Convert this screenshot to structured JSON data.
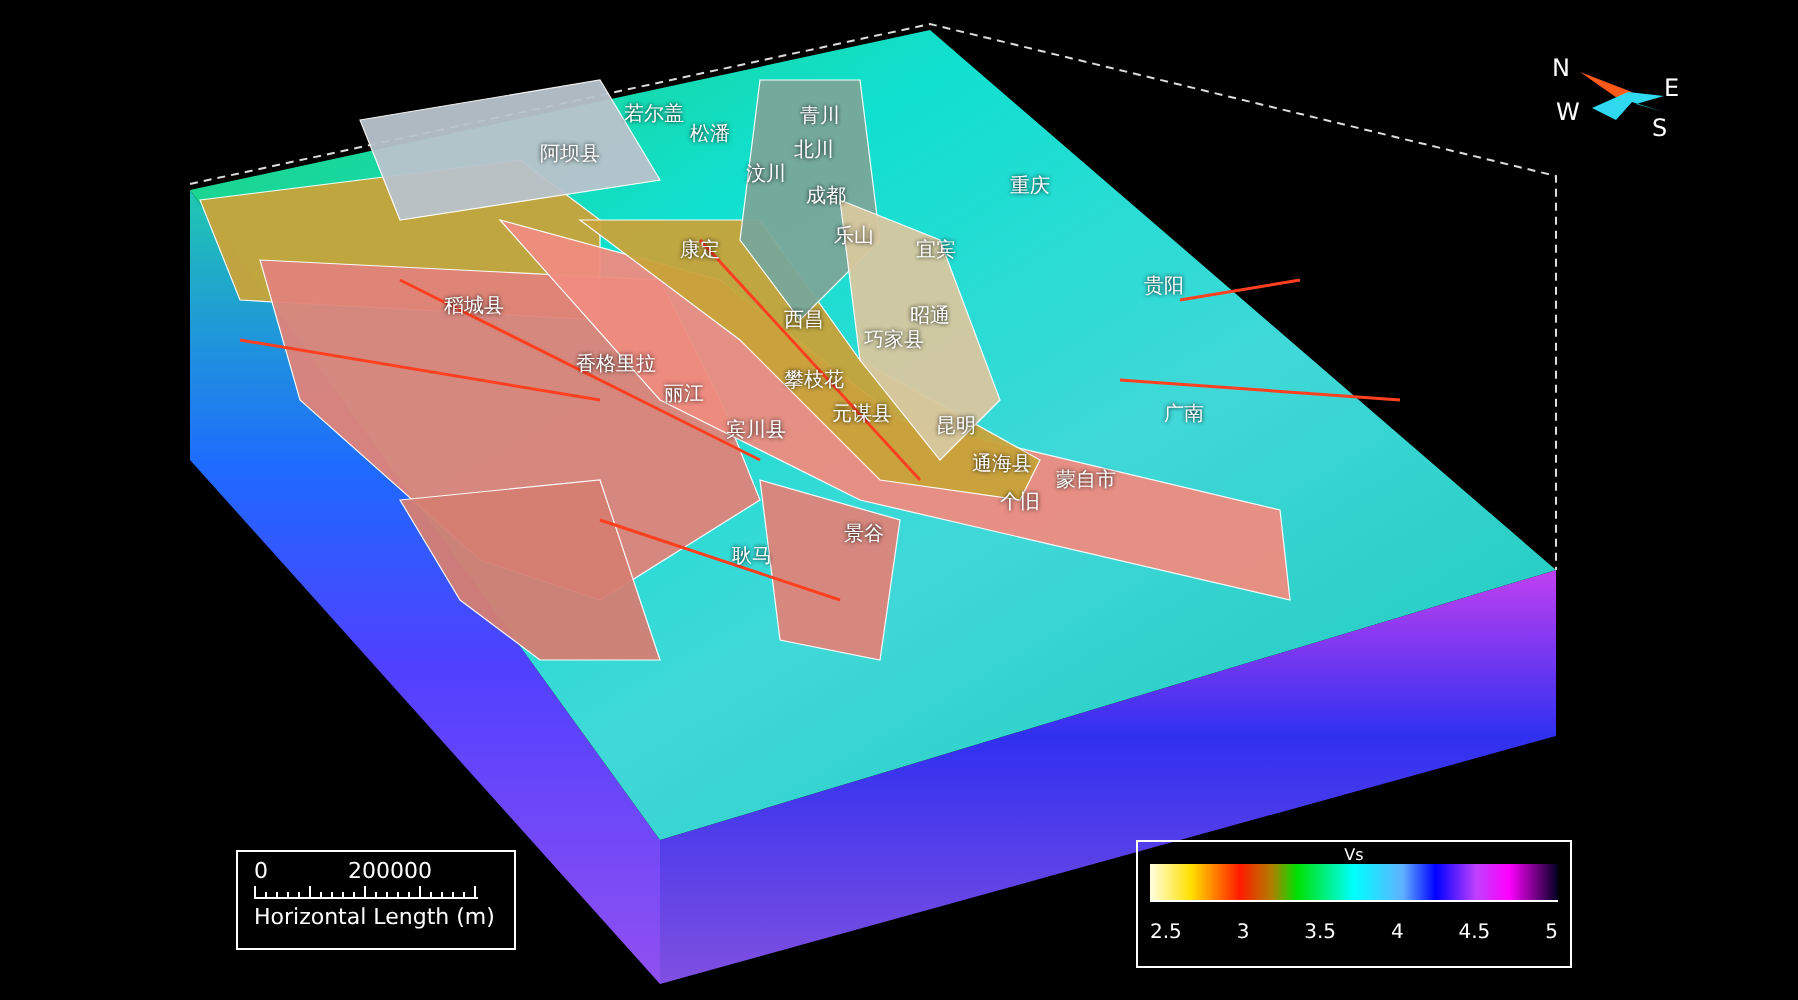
{
  "place_labels": [
    "若尔盖",
    "阿坝县",
    "松潘",
    "青川",
    "北川",
    "汶川",
    "成都",
    "康定",
    "乐山",
    "宜宾",
    "重庆",
    "贵阳",
    "稻城县",
    "西昌",
    "昭通",
    "巧家县",
    "香格里拉",
    "攀枝花",
    "丽江",
    "宾川县",
    "元谋县",
    "昆明",
    "广南",
    "通海县",
    "蒙自市",
    "个旧",
    "景谷",
    "耿马"
  ],
  "compass": {
    "north": "N",
    "east": "E",
    "west": "W",
    "south": "S"
  },
  "scale_bar": {
    "ticks": [
      "0",
      "200000"
    ],
    "label": "Horizontal Length (m)"
  },
  "color_bar": {
    "title": "Vs",
    "ticks": [
      "2.5",
      "3",
      "3.5",
      "4",
      "4.5",
      "5"
    ]
  }
}
